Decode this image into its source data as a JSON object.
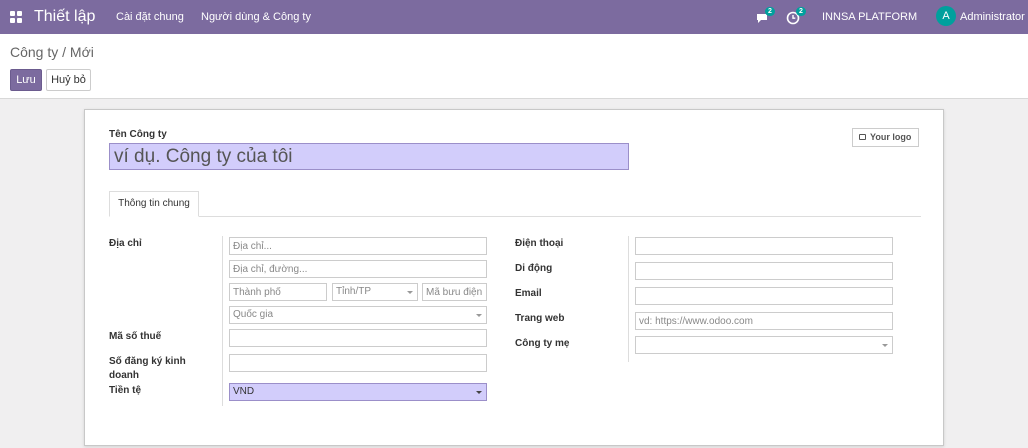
{
  "navbar": {
    "app_title": "Thiết lập",
    "menu": [
      "Cài đặt chung",
      "Người dùng & Công ty"
    ],
    "chat_count": "2",
    "activity_count": "2",
    "company": "INNSA PLATFORM",
    "avatar_letter": "A",
    "user": "Administrator",
    "color": "#7c6b9f"
  },
  "control_panel": {
    "breadcrumb": "Công ty / Mới",
    "save_label": "Lưu",
    "discard_label": "Huỷ bỏ"
  },
  "form": {
    "name_label": "Tên Công ty",
    "name_placeholder": "ví dụ. Công ty của tôi",
    "logo_label": "Your logo",
    "tab_general": "Thông tin chung",
    "left": {
      "address_label": "Địa chỉ",
      "street_placeholder": "Địa chỉ...",
      "street2_placeholder": "Địa chỉ, đường...",
      "city_placeholder": "Thành phố",
      "state_placeholder": "Tỉnh/TP",
      "zip_placeholder": "Mã bưu điện",
      "country_placeholder": "Quốc gia",
      "vat_label": "Mã số thuế",
      "registry_label": "Số đăng ký kinh doanh",
      "currency_label": "Tiền tệ",
      "currency_value": "VND"
    },
    "right": {
      "phone_label": "Điện thoại",
      "mobile_label": "Di động",
      "email_label": "Email",
      "website_label": "Trang web",
      "website_placeholder": "vd: https://www.odoo.com",
      "parent_label": "Công ty mẹ"
    }
  }
}
